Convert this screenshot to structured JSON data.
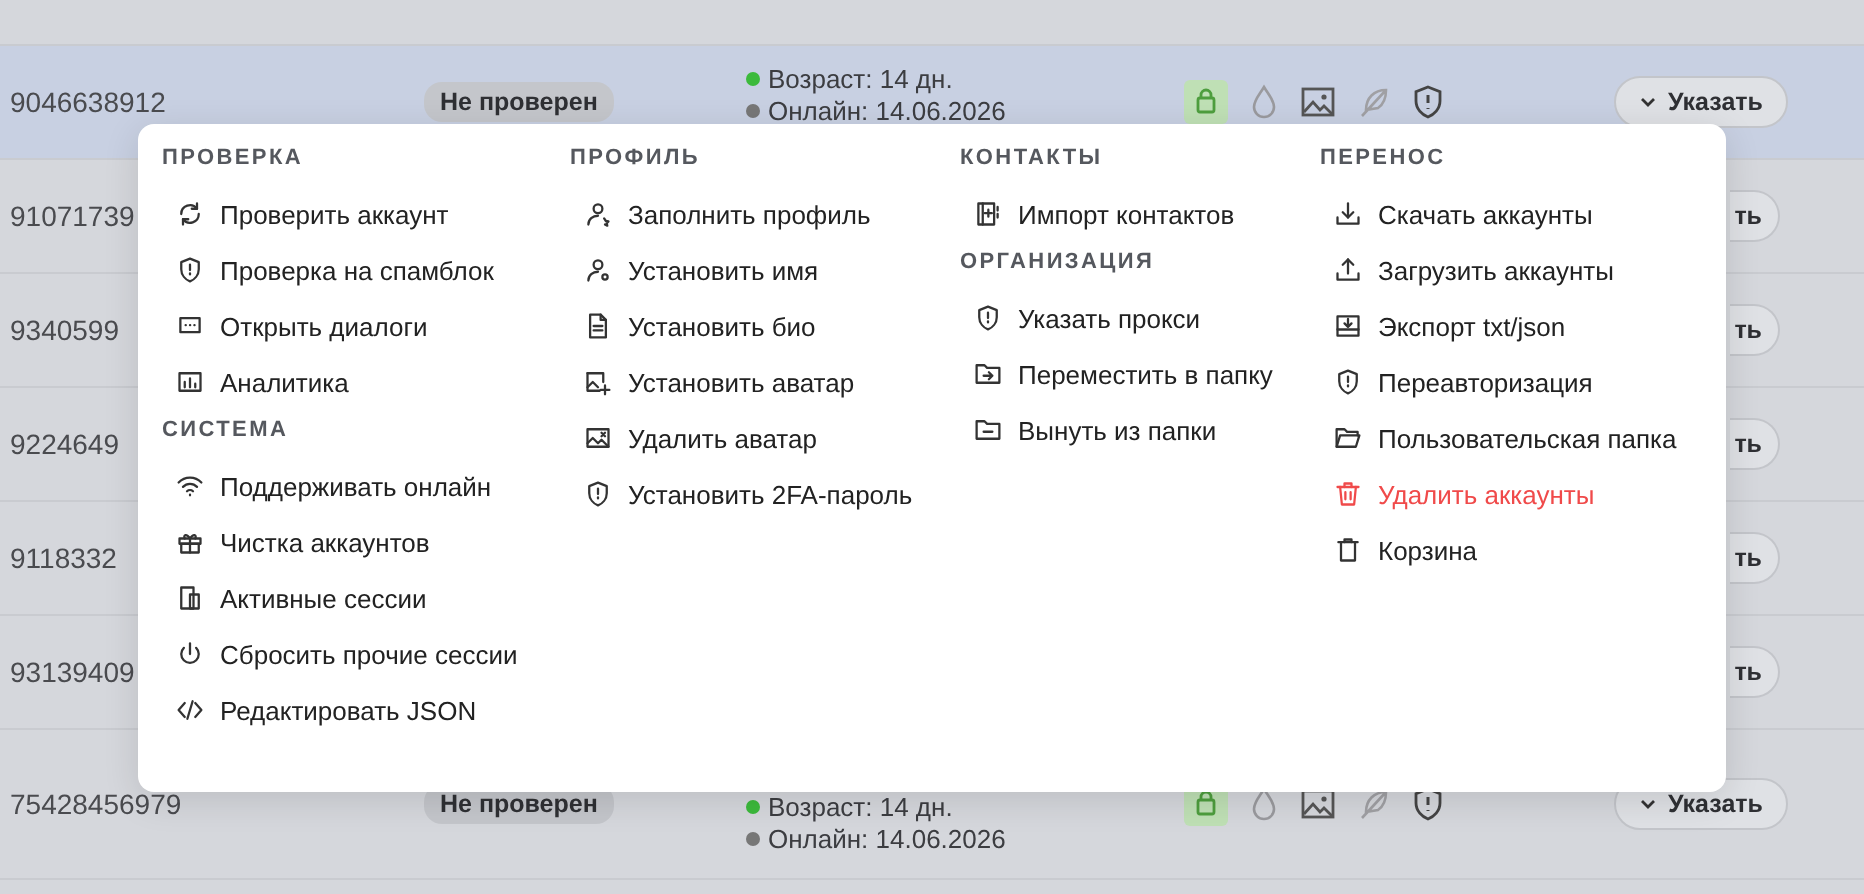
{
  "table": {
    "rows": [
      {
        "kind": "partial"
      },
      {
        "kind": "full",
        "selected": true,
        "phone": "9046638912",
        "badge": "Не проверен",
        "status_lines": [
          {
            "text": "Возраст: 14 дн.",
            "color": "#3cba3c"
          },
          {
            "text": "Онлайн: 14.06.2026",
            "color": "#777777"
          }
        ],
        "action": "Указать"
      },
      {
        "kind": "covered",
        "phone": "91071739",
        "action": "ть"
      },
      {
        "kind": "covered",
        "phone": "9340599",
        "action": "ть"
      },
      {
        "kind": "covered",
        "phone": "9224649",
        "action": "ть"
      },
      {
        "kind": "covered",
        "phone": "9118332",
        "action": "ть"
      },
      {
        "kind": "covered",
        "phone": "93139409",
        "action": "ть"
      },
      {
        "kind": "full",
        "selected": false,
        "phone": "75428456979",
        "badge": "Не проверен",
        "status_lines": [
          {
            "text": "Возраст: 14 дн.",
            "color": "#3cba3c"
          },
          {
            "text": "Онлайн: 14.06.2026",
            "color": "#777777"
          }
        ],
        "action": "Указать"
      }
    ]
  },
  "menu": {
    "columns": [
      {
        "sections": [
          {
            "heading": "ПРОВЕРКА",
            "items": [
              {
                "label": "Проверить аккаунт",
                "kind": "normal"
              },
              {
                "label": "Проверка на спамблок",
                "kind": "normal"
              },
              {
                "label": "Открыть диалоги",
                "kind": "normal"
              },
              {
                "label": "Аналитика",
                "kind": "normal"
              }
            ]
          },
          {
            "heading": "СИСТЕМА",
            "items": [
              {
                "label": "Поддерживать онлайн",
                "kind": "normal"
              },
              {
                "label": "Чистка аккаунтов",
                "kind": "normal"
              },
              {
                "label": "Активные сессии",
                "kind": "normal"
              },
              {
                "label": "Сбросить прочие сессии",
                "kind": "normal"
              },
              {
                "label": "Редактировать JSON",
                "kind": "normal"
              }
            ]
          }
        ]
      },
      {
        "sections": [
          {
            "heading": "ПРОФИЛЬ",
            "items": [
              {
                "label": "Заполнить профиль",
                "kind": "normal"
              },
              {
                "label": "Установить имя",
                "kind": "normal"
              },
              {
                "label": "Установить био",
                "kind": "normal"
              },
              {
                "label": "Установить аватар",
                "kind": "normal"
              },
              {
                "label": "Удалить аватар",
                "kind": "normal"
              },
              {
                "label": "Установить 2FA-пароль",
                "kind": "normal"
              }
            ]
          }
        ]
      },
      {
        "sections": [
          {
            "heading": "КОНТАКТЫ",
            "items": [
              {
                "label": "Импорт контактов",
                "kind": "normal"
              }
            ]
          },
          {
            "heading": "ОРГАНИЗАЦИЯ",
            "items": [
              {
                "label": "Указать прокси",
                "kind": "normal"
              },
              {
                "label": "Переместить в папку",
                "kind": "normal"
              },
              {
                "label": "Вынуть из папки",
                "kind": "normal"
              }
            ]
          }
        ]
      },
      {
        "sections": [
          {
            "heading": "ПЕРЕНОС",
            "items": [
              {
                "label": "Скачать аккаунты",
                "kind": "normal"
              },
              {
                "label": "Загрузить аккаунты",
                "kind": "normal"
              },
              {
                "label": "Экспорт txt/json",
                "kind": "normal"
              },
              {
                "label": "Переавторизация",
                "kind": "normal"
              },
              {
                "label": "Пользовательская папка",
                "kind": "normal"
              },
              {
                "label": "Удалить аккаунты",
                "kind": "danger"
              },
              {
                "label": "Корзина",
                "kind": "normal"
              }
            ]
          }
        ]
      }
    ]
  }
}
